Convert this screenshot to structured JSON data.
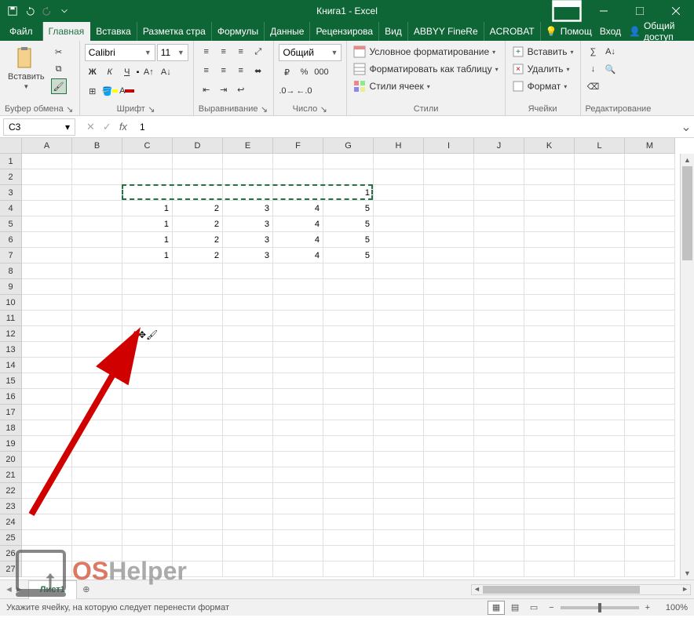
{
  "titlebar": {
    "title": "Книга1 - Excel"
  },
  "tabs": {
    "file": "Файл",
    "items": [
      "Главная",
      "Вставка",
      "Разметка стра",
      "Формулы",
      "Данные",
      "Рецензирова",
      "Вид",
      "ABBYY FineRe",
      "ACROBAT"
    ],
    "active_index": 0,
    "help": "Помощ",
    "signin": "Вход",
    "share": "Общий доступ"
  },
  "ribbon": {
    "clipboard": {
      "paste": "Вставить",
      "title": "Буфер обмена"
    },
    "font": {
      "name": "Calibri",
      "size": "11",
      "bold": "Ж",
      "italic": "К",
      "underline": "Ч",
      "title": "Шрифт"
    },
    "alignment": {
      "title": "Выравнивание"
    },
    "number": {
      "format": "Общий",
      "title": "Число"
    },
    "styles": {
      "conditional": "Условное форматирование",
      "table": "Форматировать как таблицу",
      "cell_styles": "Стили ячеек",
      "title": "Стили"
    },
    "cells": {
      "insert": "Вставить",
      "delete": "Удалить",
      "format": "Формат",
      "title": "Ячейки"
    },
    "editing": {
      "title": "Редактирование"
    }
  },
  "namebox": "C3",
  "formula": "1",
  "columns": [
    "A",
    "B",
    "C",
    "D",
    "E",
    "F",
    "G",
    "H",
    "I",
    "J",
    "K",
    "L",
    "M"
  ],
  "row_count": 27,
  "grid": {
    "marching_ants": {
      "row": 3,
      "col_start": 3,
      "col_end": 7,
      "end_value": "1"
    },
    "data_rows": [
      {
        "r": 4,
        "values": [
          "1",
          "2",
          "3",
          "4",
          "5"
        ]
      },
      {
        "r": 5,
        "values": [
          "1",
          "2",
          "3",
          "4",
          "5"
        ]
      },
      {
        "r": 6,
        "values": [
          "1",
          "2",
          "3",
          "4",
          "5"
        ]
      },
      {
        "r": 7,
        "values": [
          "1",
          "2",
          "3",
          "4",
          "5"
        ]
      }
    ],
    "data_col_start": 3
  },
  "cursor_overlay": {
    "row": 12,
    "col": 3
  },
  "sheets": {
    "nav_prev": "◄",
    "nav_next": "►",
    "active": "Лист1",
    "add": "⊕"
  },
  "status": {
    "message": "Укажите ячейку, на которую следует перенести формат",
    "zoom": "100%"
  },
  "watermark": {
    "os": "OS",
    "helper": "Helper"
  }
}
